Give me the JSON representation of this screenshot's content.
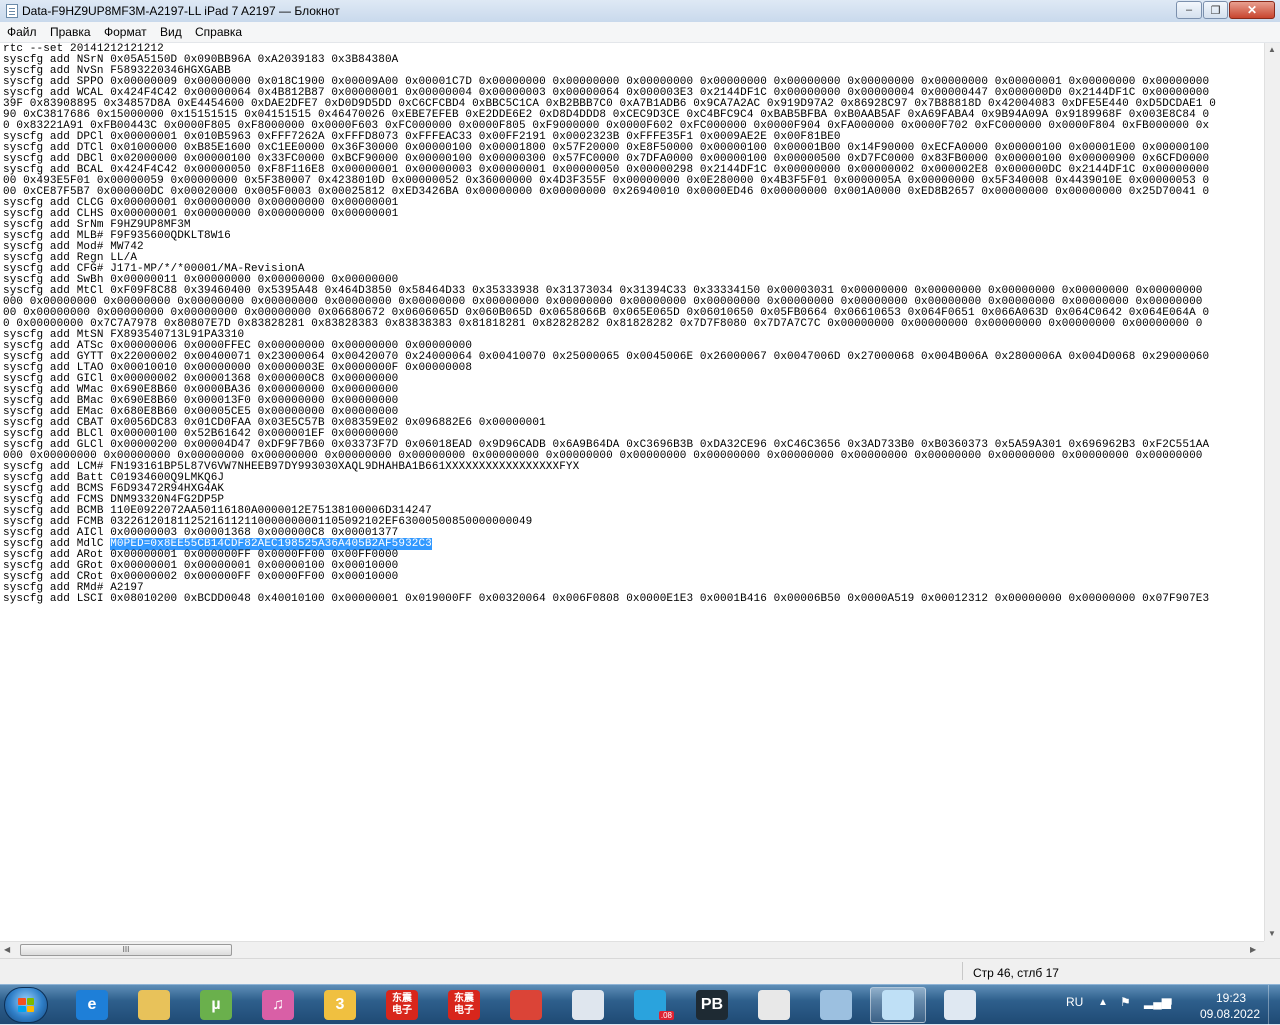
{
  "window": {
    "title": "Data-F9HZ9UP8MF3M-A2197-LL  iPad 7 A2197 — Блокнот",
    "minimize_glyph": "–",
    "maximize_glyph": "❐",
    "close_glyph": "✕"
  },
  "menu": [
    "Файл",
    "Правка",
    "Формат",
    "Вид",
    "Справка"
  ],
  "editor": {
    "selected_text": "M0PED=0x8EE55CB14CDF82AEC198525A36A405B2AF5932C3",
    "lines": [
      "rtc --set 20141212121212",
      "syscfg add NSrN 0x05A5150D 0x090BB96A 0xA2039183 0x3B84380A",
      "syscfg add NvSn F5893220346HGXGABB",
      "syscfg add SPPO 0x00000009 0x00000000 0x018C1900 0x00009A00 0x00001C7D 0x00000000 0x00000000 0x00000000 0x00000000 0x00000000 0x00000000 0x00000000 0x00000001 0x00000000 0x00000000",
      "syscfg add WCAL 0x424F4C42 0x00000064 0x4B812B87 0x00000001 0x00000004 0x00000003 0x00000064 0x000003E3 0x2144DF1C 0x00000000 0x00000004 0x00000447 0x000000D0 0x2144DF1C 0x00000000",
      "39F 0x83908895 0x34857D8A 0xE4454600 0xDAE2DFE7 0xD0D9D5DD 0xC6CFCBD4 0xBBC5C1CA 0xB2BBB7C0 0xA7B1ADB6 0x9CA7A2AC 0x919D97A2 0x86928C97 0x7B88818D 0x42004083 0xDFE5E440 0xD5DCDAE1 0",
      "90 0xC3817686 0x15000000 0x15151515 0x04151515 0x46470026 0xEBE7EFEB 0xE2DDE6E2 0xD8D4DDD8 0xCEC9D3CE 0xC4BFC9C4 0xBAB5BFBA 0xB0AAB5AF 0xA69FABA4 0x9B94A09A 0x9189968F 0x003E8C84 0",
      "0 0x83221A91 0xFB00443C 0x0000F805 0xF8000000 0x0000F603 0xFC000000 0x0000F805 0xF9000000 0x0000F602 0xFC000000 0x0000F904 0xFA000000 0x0000F702 0xFC000000 0x0000F804 0xFB000000 0x",
      "syscfg add DPCl 0x00000001 0x010B5963 0xFFF7262A 0xFFFD8073 0xFFFEAC33 0x00FF2191 0x0002323B 0xFFFE35F1 0x0009AE2E 0x00F81BE0",
      "syscfg add DTCl 0x01000000 0xB85E1600 0xC1EE0000 0x36F30000 0x00000100 0x00001800 0x57F20000 0xE8F50000 0x00000100 0x00001B00 0x14F90000 0xECFA0000 0x00000100 0x00001E00 0x00000100",
      "syscfg add DBCl 0x02000000 0x00000100 0x33FC0000 0xBCF90000 0x00000100 0x00000300 0x57FC0000 0x7DFA0000 0x00000100 0x00000500 0xD7FC0000 0x83FB0000 0x00000100 0x00000900 0x6CFD0000",
      "syscfg add BCAL 0x424F4C42 0x00000050 0xF8F116E8 0x00000001 0x00000003 0x00000001 0x00000050 0x00000298 0x2144DF1C 0x00000000 0x00000002 0x000002E8 0x000000DC 0x2144DF1C 0x00000000",
      "00 0x493E5F01 0x00000059 0x00000000 0x5F380007 0x4238010D 0x00000052 0x36000000 0x4D3F355F 0x00000000 0x0E280000 0x4B3F5F01 0x0000005A 0x00000000 0x5F340008 0x4439010E 0x00000053 0",
      "00 0xCE87F5B7 0x000000DC 0x00020000 0x005F0003 0x00025812 0xED3426BA 0x00000000 0x00000000 0x26940010 0x0000ED46 0x00000000 0x001A0000 0xED8B2657 0x00000000 0x00000000 0x25D70041 0",
      "syscfg add CLCG 0x00000001 0x00000000 0x00000000 0x00000001",
      "syscfg add CLHS 0x00000001 0x00000000 0x00000000 0x00000001",
      "syscfg add SrNm F9HZ9UP8MF3M",
      "syscfg add MLB# F9F935600QDKLT8W16",
      "syscfg add Mod# MW742",
      "syscfg add Regn LL/A",
      "syscfg add CFG# J171-MP/*/*00001/MA-RevisionA",
      "syscfg add SwBh 0x00000011 0x00000000 0x00000000 0x00000000",
      "syscfg add MtCl 0xF09F8C88 0x39460400 0x5395A48 0x464D3850 0x58464D33 0x35333938 0x31373034 0x31394C33 0x33334150 0x00003031 0x00000000 0x00000000 0x00000000 0x00000000 0x00000000",
      "000 0x00000000 0x00000000 0x00000000 0x00000000 0x00000000 0x00000000 0x00000000 0x00000000 0x00000000 0x00000000 0x00000000 0x00000000 0x00000000 0x00000000 0x00000000 0x00000000",
      "00 0x00000000 0x00000000 0x00000000 0x00000000 0x06680672 0x0606065D 0x060B065D 0x0658066B 0x065E065D 0x06010650 0x05FB0664 0x06610653 0x064F0651 0x066A063D 0x064C0642 0x064E064A 0",
      "0 0x00000000 0x7C7A7978 0x80807E7D 0x83828281 0x83828383 0x83838383 0x81818281 0x82828282 0x81828282 0x7D7F8080 0x7D7A7C7C 0x00000000 0x00000000 0x00000000 0x00000000 0x00000000 0",
      "syscfg add MtSN FX893540713L91PA3310",
      "syscfg add ATSc 0x00000006 0x0000FFEC 0x00000000 0x00000000 0x00000000",
      "syscfg add GYTT 0x22000002 0x00400071 0x23000064 0x00420070 0x24000064 0x00410070 0x25000065 0x0045006E 0x26000067 0x0047006D 0x27000068 0x004B006A 0x2800006A 0x004D0068 0x29000060",
      "syscfg add LTAO 0x00010010 0x00000000 0x0000003E 0x0000000F 0x00000008",
      "syscfg add GICl 0x00000002 0x00001368 0x000000C8 0x00000000",
      "syscfg add WMac 0x690E8B60 0x0000BA36 0x00000000 0x00000000",
      "syscfg add BMac 0x690E8B60 0x000013F0 0x00000000 0x00000000",
      "syscfg add EMac 0x680E8B60 0x00005CE5 0x00000000 0x00000000",
      "syscfg add CBAT 0x0056DC83 0x01CD0FAA 0x03E5C57B 0x08359E02 0x096882E6 0x00000001",
      "syscfg add BLCl 0x00000100 0x52B61642 0x000001EF 0x00000000",
      "syscfg add GLCl 0x00000200 0x00004D47 0xDF9F7B60 0x03373F7D 0x06018EAD 0x9D96CADB 0x6A9B64DA 0xC3696B3B 0xDA32CE96 0xC46C3656 0x3AD733B0 0xB0360373 0x5A59A301 0x696962B3 0xF2C551AA",
      "000 0x00000000 0x00000000 0x00000000 0x00000000 0x00000000 0x00000000 0x00000000 0x00000000 0x00000000 0x00000000 0x00000000 0x00000000 0x00000000 0x00000000 0x00000000 0x00000000",
      "syscfg add LCM# FN193161BP5L87V6VW7NHEEB97DY993030XAQL9DHAHBA1B661XXXXXXXXXXXXXXXXXFYX",
      "syscfg add Batt C01934600Q9LMKQ6J",
      "syscfg add BCMS F6D93472R94HXG4AK",
      "syscfg add FCMS DNM93320N4FG2DP5P",
      "syscfg add BCMB 110E0922072AA50116180A0000012E75138100006D314247",
      "syscfg add FCMB 03226120181125216112110000000001105092102EF63000500850000000049",
      "syscfg add AICl 0x00000003 0x00001368 0x000000C8 0x00001377",
      "syscfg add MdlC ",
      "syscfg add ARot 0x00000001 0x000000FF 0x0000FF00 0x00FF0000",
      "syscfg add GRot 0x00000001 0x00000001 0x00000100 0x00010000",
      "syscfg add CRot 0x00000002 0x000000FF 0x0000FF00 0x00010000",
      "syscfg add RMd# A2197",
      "syscfg add LSCI 0x08010200 0xBCDD0048 0x40010100 0x00000001 0x019000FF 0x00320064 0x006F0808 0x0000E1E3 0x0001B416 0x00006B50 0x0000A519 0x00012312 0x00000000 0x00000000 0x07F907E3"
    ]
  },
  "scrollbar": {
    "thumb_glyph": "III"
  },
  "status": {
    "cursor_position": "Стр 46, стлб 17"
  },
  "taskbar": {
    "apps": [
      {
        "name": "internet-explorer",
        "label": "e",
        "color": "#1e7fd8"
      },
      {
        "name": "file-explorer",
        "label": "",
        "color": "#e8c25a"
      },
      {
        "name": "utorrent",
        "label": "µ",
        "color": "#6ab04c"
      },
      {
        "name": "itunes",
        "label": "♫",
        "color": "#d95fa6"
      },
      {
        "name": "app-3",
        "label": "3",
        "color": "#f0c040"
      },
      {
        "name": "dongfang-app-1",
        "label": "东震\n电子",
        "color": "#d8261c"
      },
      {
        "name": "dongfang-app-2",
        "label": "东震\n电子",
        "color": "#d8261c"
      },
      {
        "name": "chrome",
        "label": "",
        "color": "#db4437"
      },
      {
        "name": "calculator",
        "label": "",
        "color": "#dfe6ee"
      },
      {
        "name": "telegram",
        "label": "",
        "color": "#2aa3dd"
      },
      {
        "name": "pb-app",
        "label": "PB",
        "color": "#1e2a33"
      },
      {
        "name": "acrobat-reader",
        "label": "",
        "color": "#e8e8e8"
      },
      {
        "name": "paint",
        "label": "",
        "color": "#9cc0e0"
      },
      {
        "name": "notepad",
        "label": "",
        "color": "#bfe0f6"
      },
      {
        "name": "compass-app",
        "label": "",
        "color": "#dfe8f2"
      }
    ],
    "telegram_badge": ".08",
    "tray": {
      "language": "RU",
      "time": "19:23",
      "date": "09.08.2022"
    }
  }
}
